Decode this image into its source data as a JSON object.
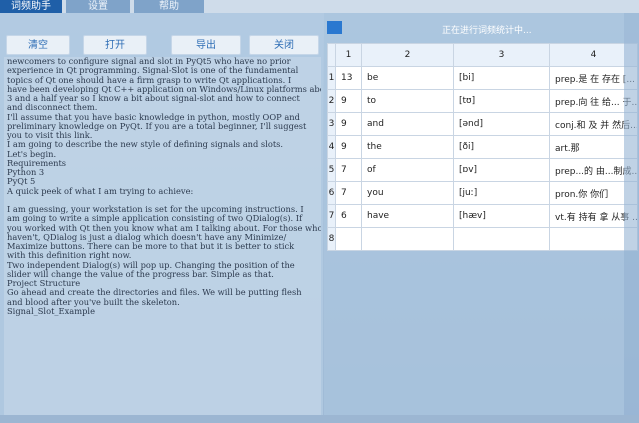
{
  "menu": {
    "tabs": [
      {
        "label": "词频助手"
      },
      {
        "label": "设置"
      },
      {
        "label": "帮助"
      }
    ]
  },
  "toolbar": {
    "clear_label": "清空",
    "open_label": "打开",
    "export_label": "导出",
    "close_label": "关闭"
  },
  "editor": {
    "lines": [
      " newcomers to configure signal and slot in PyQt5 who have no prior",
      "experience in Qt programming. Signal-Slot is one of the fundamental",
      "topics of Qt one should have a firm grasp to write Qt applications. I",
      "have been developing Qt C++ application on Windows/Linux platforms about",
      "3 and a half year so I know a bit about signal-slot and how to connect",
      "and disconnect them.",
      "I'll assume that you have basic knowledge in python, mostly OOP and",
      "preliminary knowledge on PyQt. If you are a total beginner, I'll suggest",
      "you to visit this link.",
      "I am going to describe the new style of defining signals and slots.",
      "Let's begin.",
      "Requirements",
      "Python 3",
      "PyQt 5",
      "A quick peek of what I am trying to achieve:",
      "",
      "I am guessing, your workstation is set for the upcoming instructions. I",
      "am going to write a simple application consisting of two QDialog(s). If",
      "you worked with Qt then you know what am I talking about. For those who",
      "haven't, QDialog is just a dialog which doesn't have any Minimize/",
      "Maximize buttons. There can be more to that but it is better to stick",
      "with this definition right now.",
      "Two independent Dialog(s) will pop up. Changing the position of the",
      "slider will change the value of the progress bar. Simple as that.",
      "Project Structure",
      "Go ahead and create the directories and files. We will be putting flesh",
      "and blood after you've built the skeleton.",
      "Signal_Slot_Example"
    ]
  },
  "status": {
    "text": "正在进行词频统计中..."
  },
  "table": {
    "columns": [
      "1",
      "2",
      "3",
      "4"
    ],
    "rows": [
      {
        "num": "1",
        "cells": [
          "13",
          "be",
          "[bi]",
          "prep.是 在 存在 [..."
        ]
      },
      {
        "num": "2",
        "cells": [
          "9",
          "to",
          "[tʊ]",
          "prep.向 往 给... 于..."
        ]
      },
      {
        "num": "3",
        "cells": [
          "9",
          "and",
          "[ənd]",
          "conj.和 及 并 然后..."
        ]
      },
      {
        "num": "4",
        "cells": [
          "9",
          "the",
          "[ði]",
          "art.那"
        ]
      },
      {
        "num": "5",
        "cells": [
          "7",
          "of",
          "[ɒv]",
          "prep...的 由...制成..."
        ]
      },
      {
        "num": "6",
        "cells": [
          "7",
          "you",
          "[juː]",
          "pron.你 你们"
        ]
      },
      {
        "num": "7",
        "cells": [
          "6",
          "have",
          "[hæv]",
          "vt.有 持有 拿 从事 ..."
        ]
      },
      {
        "num": "8",
        "cells": [
          "",
          "",
          "",
          ""
        ]
      }
    ]
  },
  "colors": {
    "accent": "#1f5fa8",
    "button_text": "#2d6db5",
    "status_square": "#2a78d0"
  }
}
